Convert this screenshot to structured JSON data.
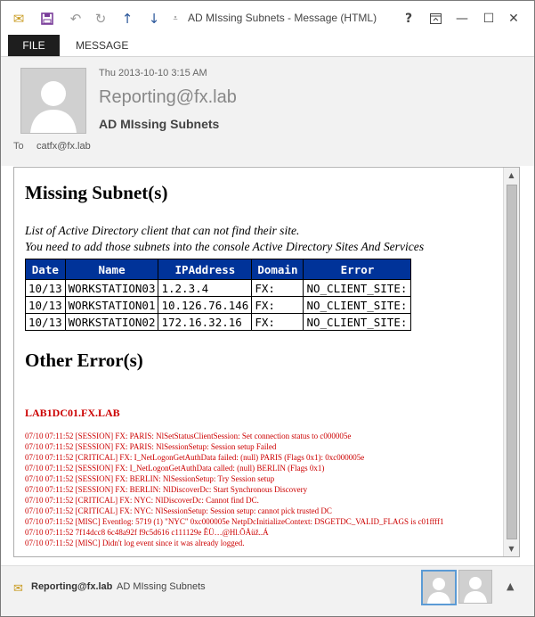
{
  "window": {
    "title": "AD MIssing Subnets - Message (HTML)"
  },
  "ribbon": {
    "file_tab": "FILE",
    "message_tab": "MESSAGE"
  },
  "header": {
    "date": "Thu 2013-10-10 3:15 AM",
    "from": "Reporting@fx.lab",
    "subject": "AD MIssing Subnets",
    "to_label": "To",
    "to_value": "catfx@fx.lab"
  },
  "body": {
    "title1": "Missing Subnet(s)",
    "intro_line1": "List of Active Directory client that can not find their site.",
    "intro_line2": "You need to add those subnets into the console Active Directory Sites And Services",
    "table": {
      "headers": [
        "Date",
        "Name",
        "IPAddress",
        "Domain",
        "Error"
      ],
      "rows": [
        [
          "10/13",
          "WORKSTATION03",
          "1.2.3.4",
          "FX:",
          "NO_CLIENT_SITE:"
        ],
        [
          "10/13",
          "WORKSTATION01",
          "10.126.76.146",
          "FX:",
          "NO_CLIENT_SITE:"
        ],
        [
          "10/13",
          "WORKSTATION02",
          "172.16.32.16",
          "FX:",
          "NO_CLIENT_SITE:"
        ]
      ]
    },
    "title2": "Other Error(s)",
    "dc_name": "LAB1DC01.FX.LAB",
    "logs": [
      "07/10 07:11:52 [SESSION] FX: PARIS: NlSetStatusClientSession: Set connection status to c000005e",
      "07/10 07:11:52 [SESSION] FX: PARIS: NlSessionSetup: Session setup Failed",
      "07/10 07:11:52 [CRITICAL] FX: I_NetLogonGetAuthData failed: (null) PARIS (Flags 0x1): 0xc000005e",
      "07/10 07:11:52 [SESSION] FX: I_NetLogonGetAuthData called: (null) BERLIN (Flags 0x1)",
      "07/10 07:11:52 [SESSION] FX: BERLIN: NlSessionSetup: Try Session setup",
      "07/10 07:11:52 [SESSION] FX: BERLIN: NlDiscoverDc: Start Synchronous Discovery",
      "07/10 07:11:52 [CRITICAL] FX: NYC: NlDiscoverDc: Cannot find DC.",
      "07/10 07:11:52 [CRITICAL] FX: NYC: NlSessionSetup: Session setup: cannot pick trusted DC",
      "07/10 07:11:52 [MISC] Eventlog: 5719 (1) \"NYC\" 0xc000005e NetpDcInitializeContext: DSGETDC_VALID_FLAGS is c01ffff1",
      "07/10 07:11:52 7f14dcc8 6c48a92f f9c5d616 c111129e ÊÜ…@Hl.ÕÅüž..Á",
      "07/10 07:11:52 [MISC] Didn't log event since it was already logged."
    ]
  },
  "footer": {
    "sender": "Reporting@fx.lab",
    "subject": "AD MIssing Subnets"
  },
  "icons": [
    "envelope-icon",
    "save-icon",
    "undo-icon",
    "redo-icon",
    "previous-item-icon",
    "next-item-icon",
    "customize-menu-icon",
    "help-icon",
    "ribbon-display-icon",
    "minimize-icon",
    "maximize-icon",
    "close-icon",
    "avatar-placeholder",
    "scroll-up-icon",
    "scroll-down-icon",
    "expand-icon"
  ],
  "colors": {
    "table_header_bg": "#003399",
    "error_text": "#cc0000",
    "accent": "#2b579a"
  }
}
